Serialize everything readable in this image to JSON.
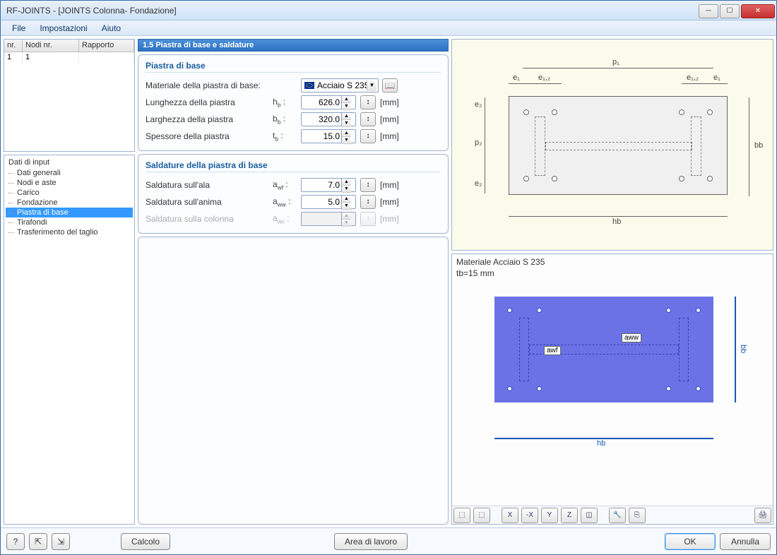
{
  "window": {
    "title": "RF-JOINTS - [JOINTS Colonna- Fondazione]"
  },
  "menu": {
    "file": "File",
    "settings": "Impostazioni",
    "help": "Aiuto"
  },
  "grid": {
    "cols": {
      "nr": "nr.",
      "nodi": "Nodi nr.",
      "rapporto": "Rapporto"
    },
    "row1": {
      "nr": "1",
      "nodi": "1",
      "rapporto": ""
    }
  },
  "tree": {
    "root": "Dati di input",
    "items": {
      "0": "Dati generali",
      "1": "Nodi e aste",
      "2": "Carico",
      "3": "Fondazione",
      "4": "Piastra di base",
      "5": "Tirafondi",
      "6": "Trasferimento del taglio"
    }
  },
  "section_title": "1.5 Piastra di base e saldature",
  "group1": {
    "title": "Piastra di base",
    "material_label": "Materiale della piastra di base:",
    "material_value": "Acciaio S 235",
    "length_label": "Lunghezza della piastra",
    "length_sym": "h",
    "length_sub": "b",
    "length_val": "626.0",
    "width_label": "Larghezza della piastra",
    "width_sym": "b",
    "width_sub": "b",
    "width_val": "320.0",
    "thick_label": "Spessore della piastra",
    "thick_sym": "t",
    "thick_sub": "b",
    "thick_val": "15.0",
    "unit": "[mm]"
  },
  "group2": {
    "title": "Saldature della piastra di base",
    "wf_label": "Saldatura sull'ala",
    "wf_sym": "a",
    "wf_sub": "wf",
    "wf_val": "7.0",
    "ww_label": "Saldatura sull'anima",
    "ww_sym": "a",
    "ww_sub": "ww",
    "ww_val": "5.0",
    "wc_label": "Saldatura sulla colonna",
    "wc_sym": "a",
    "wc_sub": "wc",
    "wc_val": "",
    "unit": "[mm]"
  },
  "diagram_labels": {
    "p1": "p₁",
    "p2": "p₂",
    "e1": "e₁",
    "e12": "e₁,₂",
    "e2": "e₂",
    "hb": "hb",
    "bb": "bb"
  },
  "preview": {
    "line1": "Materiale Acciaio S 235",
    "line2": "tb=15 mm",
    "awf": "awf",
    "aww": "aww",
    "hb": "hb",
    "bb": "bb"
  },
  "footer": {
    "calc": "Calcolo",
    "workarea": "Area di lavoro",
    "ok": "OK",
    "cancel": "Annulla"
  }
}
